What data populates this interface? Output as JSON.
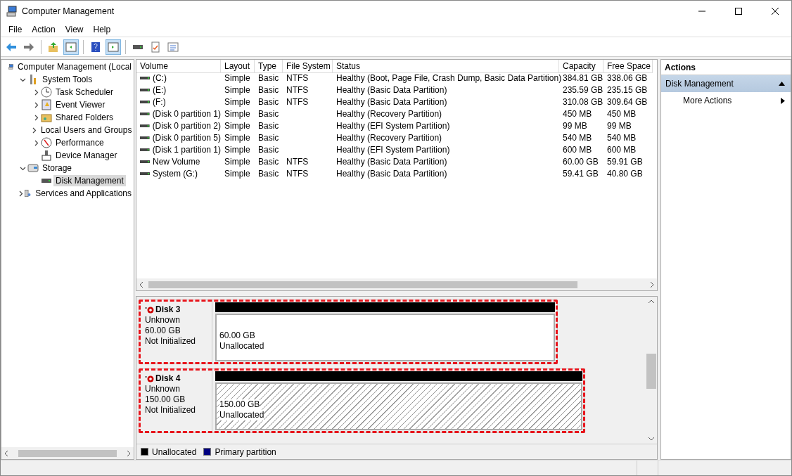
{
  "window": {
    "title": "Computer Management"
  },
  "menu": [
    "File",
    "Action",
    "View",
    "Help"
  ],
  "toolbar": [
    {
      "kind": "back",
      "selected": false
    },
    {
      "kind": "forward",
      "selected": false
    },
    {
      "kind": "sep"
    },
    {
      "kind": "up",
      "selected": false
    },
    {
      "kind": "pane",
      "selected": true
    },
    {
      "kind": "sep"
    },
    {
      "kind": "help",
      "selected": false
    },
    {
      "kind": "pane2",
      "selected": true
    },
    {
      "kind": "sep"
    },
    {
      "kind": "drive",
      "selected": false
    },
    {
      "kind": "check",
      "selected": false
    },
    {
      "kind": "list",
      "selected": false
    }
  ],
  "tree": [
    {
      "label": "Computer Management (Local",
      "selected": false,
      "children": [
        {
          "label": "System Tools",
          "expanded": true,
          "selected": false,
          "children": [
            {
              "label": "Task Scheduler",
              "expanded": false,
              "selected": false
            },
            {
              "label": "Event Viewer",
              "expanded": false,
              "selected": false
            },
            {
              "label": "Shared Folders",
              "expanded": false,
              "selected": false
            },
            {
              "label": "Local Users and Groups",
              "expanded": false,
              "selected": false
            },
            {
              "label": "Performance",
              "expanded": false,
              "selected": false
            },
            {
              "label": "Device Manager",
              "selected": false
            }
          ]
        },
        {
          "label": "Storage",
          "expanded": true,
          "selected": false,
          "children": [
            {
              "label": "Disk Management",
              "selected": true
            }
          ]
        },
        {
          "label": "Services and Applications",
          "expanded": false,
          "selected": false
        }
      ]
    }
  ],
  "table": {
    "columns": [
      "Volume",
      "Layout",
      "Type",
      "File System",
      "Status",
      "Capacity",
      "Free Space"
    ],
    "rows": [
      [
        "(C:)",
        "Simple",
        "Basic",
        "NTFS",
        "Healthy (Boot, Page File, Crash Dump, Basic Data Partition)",
        "384.81 GB",
        "338.06 GB"
      ],
      [
        "(E:)",
        "Simple",
        "Basic",
        "NTFS",
        "Healthy (Basic Data Partition)",
        "235.59 GB",
        "235.15 GB"
      ],
      [
        "(F:)",
        "Simple",
        "Basic",
        "NTFS",
        "Healthy (Basic Data Partition)",
        "310.08 GB",
        "309.64 GB"
      ],
      [
        "(Disk 0 partition 1)",
        "Simple",
        "Basic",
        "",
        "Healthy (Recovery Partition)",
        "450 MB",
        "450 MB"
      ],
      [
        "(Disk 0 partition 2)",
        "Simple",
        "Basic",
        "",
        "Healthy (EFI System Partition)",
        "99 MB",
        "99 MB"
      ],
      [
        "(Disk 0 partition 5)",
        "Simple",
        "Basic",
        "",
        "Healthy (Recovery Partition)",
        "540 MB",
        "540 MB"
      ],
      [
        "(Disk 1 partition 1)",
        "Simple",
        "Basic",
        "",
        "Healthy (EFI System Partition)",
        "600 MB",
        "600 MB"
      ],
      [
        "New Volume",
        "Simple",
        "Basic",
        "NTFS",
        "Healthy (Basic Data Partition)",
        "60.00 GB",
        "59.91 GB"
      ],
      [
        "System (G:)",
        "Simple",
        "Basic",
        "NTFS",
        "Healthy (Basic Data Partition)",
        "59.41 GB",
        "40.80 GB"
      ]
    ]
  },
  "disks": [
    {
      "name": "Disk 3",
      "type": "Unknown",
      "size": "60.00 GB",
      "state": "Not Initialized",
      "highlighted": true,
      "partition": {
        "size": "60.00 GB",
        "label": "Unallocated",
        "selected": false
      }
    },
    {
      "name": "Disk 4",
      "type": "Unknown",
      "size": "150.00 GB",
      "state": "Not Initialized",
      "highlighted": true,
      "partition": {
        "size": "150.00 GB",
        "label": "Unallocated",
        "selected": true
      }
    }
  ],
  "legend": [
    {
      "label": "Unallocated",
      "color": "#000000"
    },
    {
      "label": "Primary partition",
      "color": "#000080"
    }
  ],
  "actions": {
    "title": "Actions",
    "section": {
      "label": "Disk Management",
      "expanded": true
    },
    "items": [
      "More Actions"
    ]
  }
}
